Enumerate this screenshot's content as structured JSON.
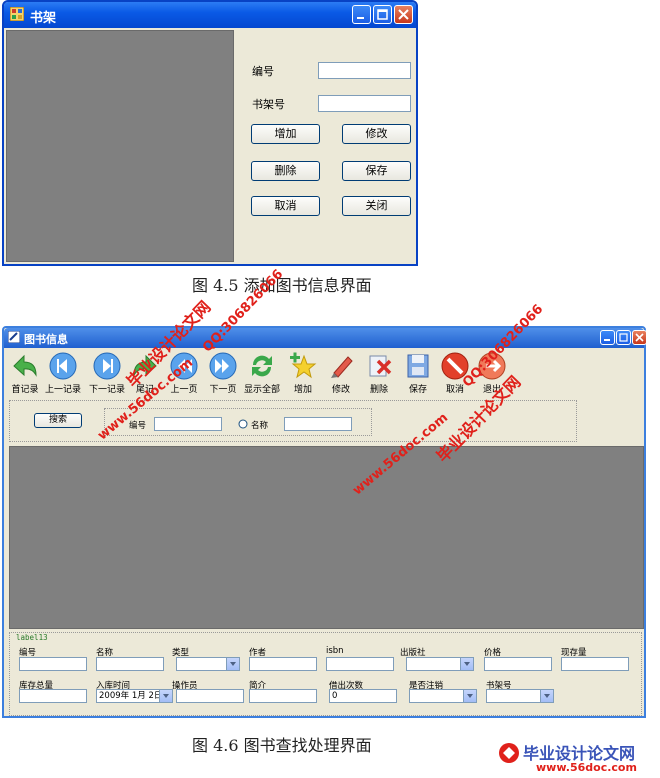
{
  "window1": {
    "title": "书架",
    "fields": {
      "id_label": "编号",
      "shelf_label": "书架号"
    },
    "buttons": {
      "add": "增加",
      "edit": "修改",
      "delete": "删除",
      "save": "保存",
      "cancel": "取消",
      "close": "关闭"
    }
  },
  "caption1": "图 4.5 添加图书信息界面",
  "window2": {
    "title": "图书信息",
    "toolbar": [
      {
        "label": "首记录",
        "icon": "back-arrow-icon"
      },
      {
        "label": "上一记录",
        "icon": "prev-record-icon"
      },
      {
        "label": "下一记录",
        "icon": "next-record-icon"
      },
      {
        "label": "尾记",
        "icon": "last-record-icon"
      },
      {
        "label": "上一页",
        "icon": "prev-page-icon"
      },
      {
        "label": "下一页",
        "icon": "next-page-icon"
      },
      {
        "label": "显示全部",
        "icon": "refresh-icon"
      },
      {
        "label": "增加",
        "icon": "star-add-icon"
      },
      {
        "label": "修改",
        "icon": "edit-icon"
      },
      {
        "label": "删除",
        "icon": "delete-icon"
      },
      {
        "label": "保存",
        "icon": "save-icon"
      },
      {
        "label": "取消",
        "icon": "cancel-icon"
      },
      {
        "label": "退出",
        "icon": "exit-icon"
      }
    ],
    "search": {
      "button": "搜索",
      "id_label": "编号",
      "name_label": "名称"
    },
    "detail": {
      "group_label": "label13",
      "row1": [
        "编号",
        "名称",
        "类型",
        "作者",
        "isbn",
        "出版社",
        "价格",
        "现存量"
      ],
      "row2": [
        "库存总量",
        "入库时间",
        "操作员",
        "简介",
        "借出次数",
        "是否注销",
        "书架号"
      ],
      "date_value": "2009年 1月 2日",
      "borrow_count_value": "0"
    }
  },
  "caption2": "图 4.6 图书查找处理界面",
  "watermarks": {
    "site": "www.56doc.com",
    "qq": "QQ:306826066",
    "brand": "毕业设计论文网",
    "bottom_brand": "毕业设计论文网",
    "bottom_site": "www.56doc.com"
  },
  "colors": {
    "titlebar": "#0a5ae6",
    "grid": "#808080",
    "window_bg": "#ece9d8",
    "watermark_red": "#e0211b",
    "watermark_blue": "#3a54b8"
  }
}
